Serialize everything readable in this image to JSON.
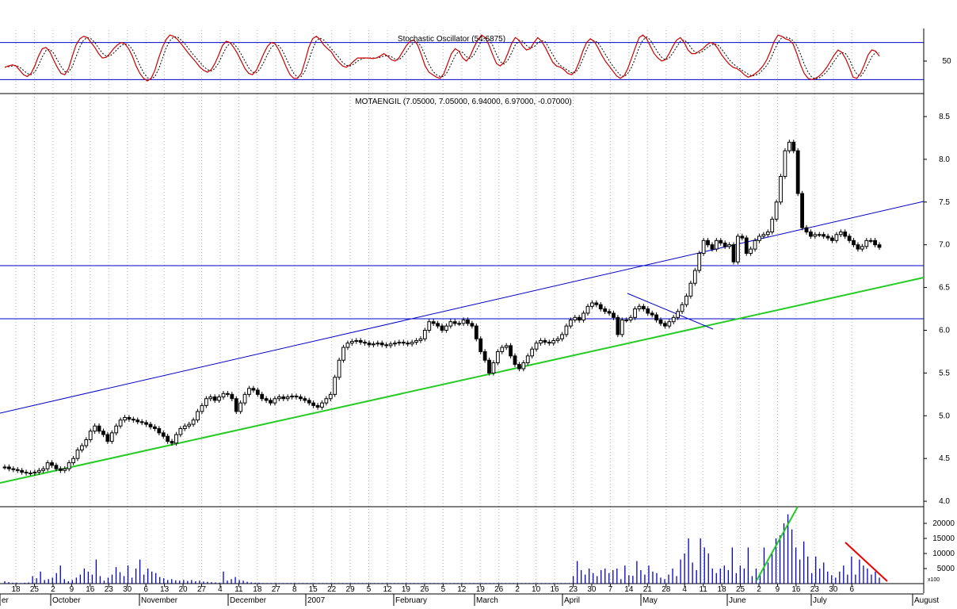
{
  "colors": {
    "background": "#ffffff",
    "candle": "#000000",
    "grid": "#b4b4b4",
    "channel_line": "#0000c8",
    "support_line": "#22cc22",
    "horizontal_line": "#0000c8",
    "stoch_k": "#cc0000",
    "stoch_d": "#000000",
    "volume_bar": "#0000c8",
    "volume_up_trend": "#22cc22",
    "volume_down_trend": "#ee0000"
  },
  "chart_data": [
    {
      "type": "line",
      "panel": "stochastic",
      "title": "Stochastic Oscillator (54.6875)",
      "ylim": [
        0,
        100
      ],
      "yticks": [
        "50"
      ],
      "bands": [
        80,
        20
      ],
      "series": [
        {
          "name": "%K",
          "values": [
            40,
            42,
            44,
            42,
            35,
            28,
            25,
            30,
            42,
            58,
            70,
            72,
            65,
            52,
            40,
            30,
            28,
            38,
            58,
            76,
            86,
            90,
            88,
            80,
            72,
            62,
            55,
            56,
            62,
            70,
            76,
            80,
            78,
            70,
            58,
            42,
            30,
            22,
            18,
            22,
            35,
            55,
            72,
            85,
            92,
            90,
            85,
            78,
            70,
            62,
            55,
            48,
            40,
            35,
            32,
            36,
            46,
            60,
            75,
            82,
            80,
            72,
            62,
            50,
            38,
            30,
            28,
            35,
            48,
            62,
            74,
            80,
            78,
            68,
            55,
            40,
            28,
            22,
            22,
            30,
            50,
            72,
            86,
            90,
            85,
            76,
            70,
            65,
            55,
            48,
            42,
            40,
            44,
            50,
            55,
            55,
            55,
            55,
            54,
            55,
            58,
            62,
            58,
            52,
            50,
            55,
            65,
            75,
            82,
            84,
            76,
            60,
            42,
            32,
            28,
            24,
            22,
            30,
            46,
            62,
            70,
            66,
            55,
            50,
            58,
            72,
            84,
            92,
            88,
            76,
            60,
            46,
            42,
            48,
            62,
            78,
            88,
            84,
            74,
            68,
            70,
            80,
            88,
            82,
            72,
            60,
            48,
            42,
            40,
            36,
            30,
            28,
            34,
            48,
            66,
            80,
            86,
            82,
            72,
            60,
            50,
            42,
            34,
            26,
            22,
            26,
            38,
            55,
            72,
            88,
            92,
            86,
            74,
            62,
            55,
            50,
            52,
            62,
            74,
            84,
            88,
            80,
            68,
            62,
            62,
            66,
            70,
            76,
            80,
            78,
            70,
            60,
            52,
            45,
            40,
            38,
            34,
            28,
            24,
            26,
            30,
            35,
            42,
            52,
            66,
            82,
            92,
            90,
            86,
            84,
            78,
            62,
            44,
            30,
            22,
            20,
            22,
            26,
            32,
            40,
            50,
            60,
            68,
            64,
            54,
            40,
            24,
            22,
            30,
            44,
            60,
            68,
            66,
            58
          ]
        },
        {
          "name": "%D",
          "values": [
            40,
            41,
            42,
            43,
            40,
            35,
            30,
            28,
            32,
            43,
            57,
            67,
            69,
            63,
            52,
            41,
            33,
            32,
            41,
            57,
            73,
            84,
            88,
            86,
            80,
            71,
            63,
            58,
            58,
            63,
            69,
            75,
            78,
            76,
            69,
            57,
            43,
            31,
            23,
            21,
            25,
            37,
            54,
            71,
            83,
            89,
            89,
            84,
            78,
            70,
            62,
            55,
            48,
            41,
            36,
            34,
            38,
            47,
            60,
            72,
            79,
            78,
            71,
            61,
            50,
            39,
            32,
            31,
            37,
            48,
            61,
            72,
            77,
            75,
            67,
            54,
            41,
            30,
            24,
            25,
            34,
            51,
            69,
            83,
            87,
            84,
            77,
            70,
            63,
            56,
            48,
            43,
            42,
            45,
            50,
            53,
            55,
            55,
            55,
            55,
            56,
            58,
            59,
            57,
            53,
            52,
            57,
            65,
            74,
            80,
            81,
            73,
            59,
            45,
            34,
            28,
            25,
            25,
            33,
            46,
            59,
            66,
            64,
            57,
            54,
            60,
            71,
            83,
            88,
            85,
            75,
            61,
            49,
            45,
            51,
            63,
            76,
            83,
            82,
            75,
            71,
            73,
            79,
            83,
            81,
            71,
            60,
            50,
            43,
            39,
            35,
            31,
            31,
            39,
            53,
            68,
            80,
            83,
            80,
            71,
            61,
            51,
            42,
            34,
            27,
            25,
            30,
            40,
            55,
            72,
            84,
            89,
            84,
            74,
            64,
            56,
            52,
            55,
            63,
            73,
            82,
            84,
            79,
            70,
            64,
            63,
            66,
            71,
            75,
            78,
            76,
            69,
            61,
            52,
            46,
            41,
            37,
            33,
            29,
            26,
            27,
            30,
            36,
            43,
            53,
            67,
            80,
            88,
            89,
            87,
            83,
            75,
            61,
            45,
            32,
            24,
            21,
            23,
            27,
            33,
            41,
            50,
            59,
            64,
            62,
            53,
            39,
            29,
            25,
            33,
            45,
            57,
            64,
            63
          ]
        }
      ]
    },
    {
      "type": "candlestick",
      "panel": "price",
      "title": "MOTAENGIL (7.05000, 7.05000, 6.94000, 6.97000, -0.07000)",
      "ylim": [
        3.9,
        8.7
      ],
      "yticks": [
        "4.0",
        "4.5",
        "5.0",
        "5.5",
        "6.0",
        "6.5",
        "7.0",
        "7.5",
        "8.0",
        "8.5"
      ],
      "close": [
        4.4,
        4.38,
        4.37,
        4.36,
        4.34,
        4.33,
        4.33,
        4.34,
        4.36,
        4.38,
        4.45,
        4.42,
        4.38,
        4.36,
        4.38,
        4.45,
        4.5,
        4.6,
        4.65,
        4.72,
        4.82,
        4.88,
        4.82,
        4.78,
        4.7,
        4.8,
        4.88,
        4.95,
        4.98,
        4.96,
        4.95,
        4.93,
        4.92,
        4.9,
        4.87,
        4.85,
        4.8,
        4.76,
        4.7,
        4.68,
        4.78,
        4.85,
        4.88,
        4.9,
        4.95,
        5.05,
        5.12,
        5.2,
        5.22,
        5.18,
        5.22,
        5.26,
        5.25,
        5.2,
        5.05,
        5.15,
        5.25,
        5.32,
        5.3,
        5.25,
        5.2,
        5.18,
        5.15,
        5.2,
        5.22,
        5.2,
        5.22,
        5.23,
        5.22,
        5.2,
        5.18,
        5.15,
        5.12,
        5.1,
        5.15,
        5.2,
        5.25,
        5.45,
        5.65,
        5.8,
        5.85,
        5.87,
        5.88,
        5.86,
        5.85,
        5.83,
        5.84,
        5.85,
        5.83,
        5.82,
        5.84,
        5.85,
        5.86,
        5.85,
        5.84,
        5.86,
        5.88,
        5.9,
        6.0,
        6.1,
        6.08,
        6.05,
        6.0,
        6.05,
        6.1,
        6.08,
        6.08,
        6.12,
        6.08,
        6.05,
        5.9,
        5.75,
        5.65,
        5.5,
        5.62,
        5.75,
        5.8,
        5.82,
        5.7,
        5.6,
        5.55,
        5.62,
        5.7,
        5.78,
        5.85,
        5.88,
        5.86,
        5.85,
        5.88,
        5.9,
        5.95,
        6.05,
        6.12,
        6.15,
        6.12,
        6.2,
        6.28,
        6.32,
        6.3,
        6.25,
        6.22,
        6.2,
        6.15,
        5.95,
        6.12,
        6.12,
        6.15,
        6.25,
        6.28,
        6.25,
        6.2,
        6.18,
        6.12,
        6.08,
        6.05,
        6.1,
        6.15,
        6.22,
        6.3,
        6.4,
        6.55,
        6.7,
        6.9,
        7.05,
        7.0,
        6.95,
        7.05,
        7.02,
        6.98,
        7.0,
        6.8,
        7.1,
        7.08,
        6.9,
        6.95,
        7.05,
        7.1,
        7.12,
        7.15,
        7.3,
        7.5,
        7.8,
        8.1,
        8.2,
        8.1,
        7.6,
        7.2,
        7.15,
        7.1,
        7.12,
        7.12,
        7.1,
        7.08,
        7.05,
        7.12,
        7.15,
        7.1,
        7.05,
        7.0,
        6.95,
        6.98,
        7.05,
        7.05,
        7.0,
        6.97
      ]
    },
    {
      "type": "bar",
      "panel": "volume",
      "ylim": [
        0,
        27000
      ],
      "yticks": [
        "5000",
        "10000",
        "15000",
        "20000"
      ],
      "scale_label": "x100",
      "values": [
        800,
        500,
        300,
        300,
        200,
        300,
        400,
        2500,
        1800,
        4000,
        1200,
        1500,
        2000,
        3500,
        6000,
        1500,
        800,
        1200,
        2000,
        3000,
        5000,
        4000,
        3000,
        8000,
        2500,
        1000,
        2000,
        3000,
        5500,
        3800,
        2500,
        6000,
        2000,
        5000,
        8000,
        3000,
        5000,
        4000,
        3500,
        2200,
        1800,
        1200,
        1500,
        1100,
        1000,
        1200,
        900,
        1200,
        800,
        1000,
        700,
        600,
        500,
        400,
        300,
        4000,
        1000,
        1500,
        2200,
        1200,
        1000,
        600,
        400,
        300,
        300,
        200,
        200,
        200,
        200,
        200,
        200,
        200,
        200,
        200,
        200,
        200,
        200,
        200,
        200,
        200,
        200,
        200,
        200,
        200,
        200,
        200,
        200,
        200,
        200,
        200,
        200,
        200,
        200,
        200,
        200,
        200,
        200,
        200,
        200,
        200,
        200,
        200,
        200,
        200,
        200,
        200,
        200,
        200,
        200,
        200,
        200,
        200,
        200,
        200,
        200,
        200,
        200,
        200,
        200,
        200,
        200,
        200,
        200,
        200,
        200,
        200,
        200,
        200,
        200,
        200,
        200,
        200,
        200,
        200,
        200,
        200,
        200,
        200,
        200,
        200,
        200,
        200,
        200,
        2500,
        7500,
        4500,
        3000,
        5000,
        3500,
        2500,
        4500,
        5000,
        3500,
        4500,
        5000,
        1500,
        6000,
        2800,
        2600,
        7500,
        4500,
        3000,
        6000,
        4000,
        3500,
        2000,
        1500,
        3000,
        5000,
        2500,
        8000,
        10000,
        15000,
        7000,
        4500,
        15000,
        12000,
        10000,
        5000,
        3500,
        5000,
        6000,
        4500,
        12000,
        3500,
        6000,
        5000,
        12000,
        2500,
        5000,
        3000,
        12000,
        7000,
        10000,
        15000,
        16000,
        20000,
        23000,
        18000,
        12000,
        8000,
        14000,
        9000,
        3500,
        9000,
        5000,
        7000,
        4000,
        2800,
        2000,
        4000,
        6000,
        3000,
        9000,
        3000,
        8000,
        6000,
        5000,
        3000,
        4000,
        2000
      ]
    }
  ],
  "x_axis": {
    "day_ticks": [
      "18",
      "25",
      "2",
      "9",
      "16",
      "23",
      "30",
      "6",
      "13",
      "20",
      "27",
      "4",
      "11",
      "18",
      "27",
      "8",
      "15",
      "22",
      "29",
      "5",
      "12",
      "19",
      "26",
      "5",
      "12",
      "19",
      "26",
      "2",
      "10",
      "16",
      "23",
      "30",
      "7",
      "14",
      "21",
      "28",
      "4",
      "11",
      "18",
      "25",
      "2",
      "9",
      "16",
      "23",
      "30",
      "6"
    ],
    "month_labels": [
      "er",
      "October",
      "November",
      "December",
      "2007",
      "February",
      "March",
      "April",
      "May",
      "June",
      "July",
      "August"
    ]
  }
}
